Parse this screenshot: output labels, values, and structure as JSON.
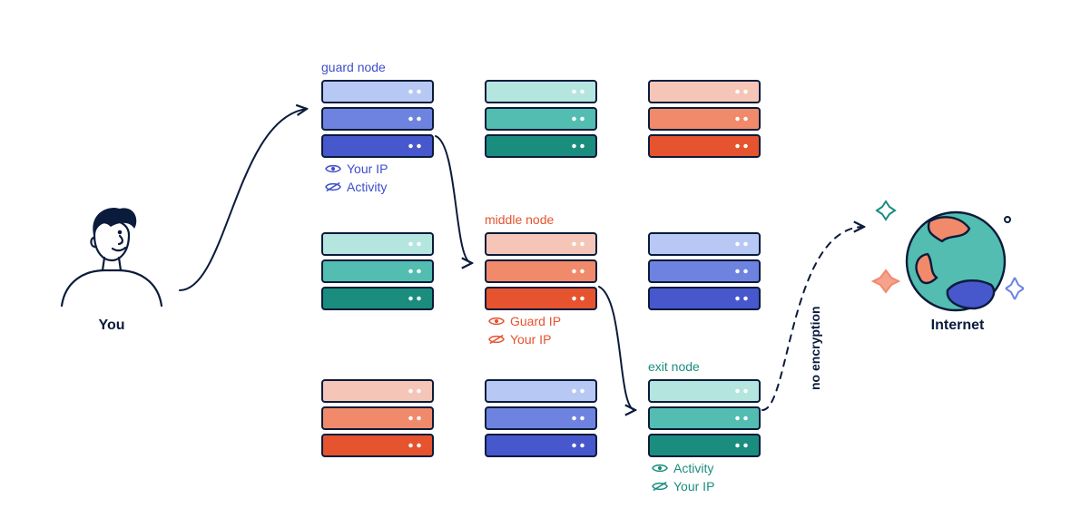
{
  "endpoints": {
    "you": "You",
    "internet": "Internet"
  },
  "nodes": {
    "guard": {
      "title": "guard node",
      "see": "Your IP",
      "hidden": "Activity"
    },
    "middle": {
      "title": "middle node",
      "see": "Guard IP",
      "hidden": "Your IP"
    },
    "exit": {
      "title": "exit node",
      "see": "Activity",
      "hidden": "Your IP"
    }
  },
  "path_label": "no encryption",
  "colors": {
    "guard": "#3e4ecb",
    "middle": "#e5532f",
    "exit": "#1a8d7f",
    "ink": "#0b1b3b"
  }
}
